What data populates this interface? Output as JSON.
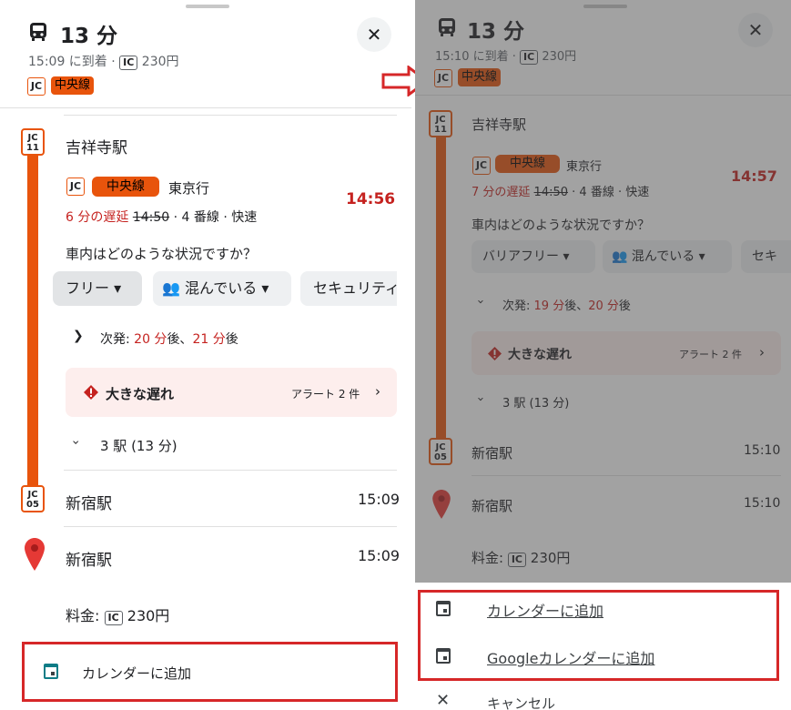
{
  "left": {
    "duration": "13 分",
    "arrival": "15:09 に到着 ·",
    "fare_badge": "IC",
    "fare": "230円",
    "line_code": "JC",
    "line_name": "中央線",
    "close": "✕",
    "origin": {
      "code_top": "JC",
      "code_num": "11",
      "name": "吉祥寺駅"
    },
    "service": {
      "line_code": "JC",
      "line_name": "中央線",
      "destination": "東京行",
      "delay": "6 分の遅延",
      "sched_time": "14:50",
      "details": "· 4 番線 · 快速",
      "departure": "14:56"
    },
    "crowd_question": "車内はどのような状況ですか？",
    "chips": [
      "フリー",
      "混んでいる",
      "セキュリティ"
    ],
    "next_label": "次発:",
    "next_a": "20 分",
    "next_sep": "後、",
    "next_b": "21 分",
    "next_suffix": "後",
    "alert_title": "大きな遅れ",
    "alert_count": "アラート 2 件",
    "stops": "3 駅 (13 分)",
    "dest": {
      "code_top": "JC",
      "code_num": "05",
      "name": "新宿駅",
      "time": "15:09"
    },
    "walk_dest": {
      "name": "新宿駅",
      "time": "15:09"
    },
    "fare_label": "料金:",
    "calendar": "カレンダーに追加"
  },
  "right": {
    "duration": "13 分",
    "arrival": "15:10 に到着 ·",
    "fare_badge": "IC",
    "fare": "230円",
    "line_code": "JC",
    "line_name": "中央線",
    "close": "✕",
    "origin": {
      "code_top": "JC",
      "code_num": "11",
      "name": "吉祥寺駅"
    },
    "service": {
      "line_code": "JC",
      "line_name": "中央線",
      "destination": "東京行",
      "delay": "7 分の遅延",
      "sched_time": "14:50",
      "details": "· 4 番線 · 快速",
      "departure": "14:57"
    },
    "crowd_question": "車内はどのような状況ですか？",
    "chips": [
      "バリアフリー",
      "混んでいる",
      "セキ"
    ],
    "next_label": "次発:",
    "next_a": "19 分",
    "next_sep": "後、",
    "next_b": "20 分",
    "next_suffix": "後",
    "alert_title": "大きな遅れ",
    "alert_count": "アラート 2 件",
    "stops": "3 駅 (13 分)",
    "dest": {
      "code_top": "JC",
      "code_num": "05",
      "name": "新宿駅",
      "time": "15:10"
    },
    "walk_dest": {
      "name": "新宿駅",
      "time": "15:10"
    },
    "fare_label": "料金:",
    "menu": [
      "カレンダーに追加",
      "Googleカレンダーに追加",
      "キャンセル"
    ]
  },
  "colors": {
    "accent_line": "#e8540c",
    "delay_red": "#c5221f",
    "highlight_frame": "#d62728"
  }
}
